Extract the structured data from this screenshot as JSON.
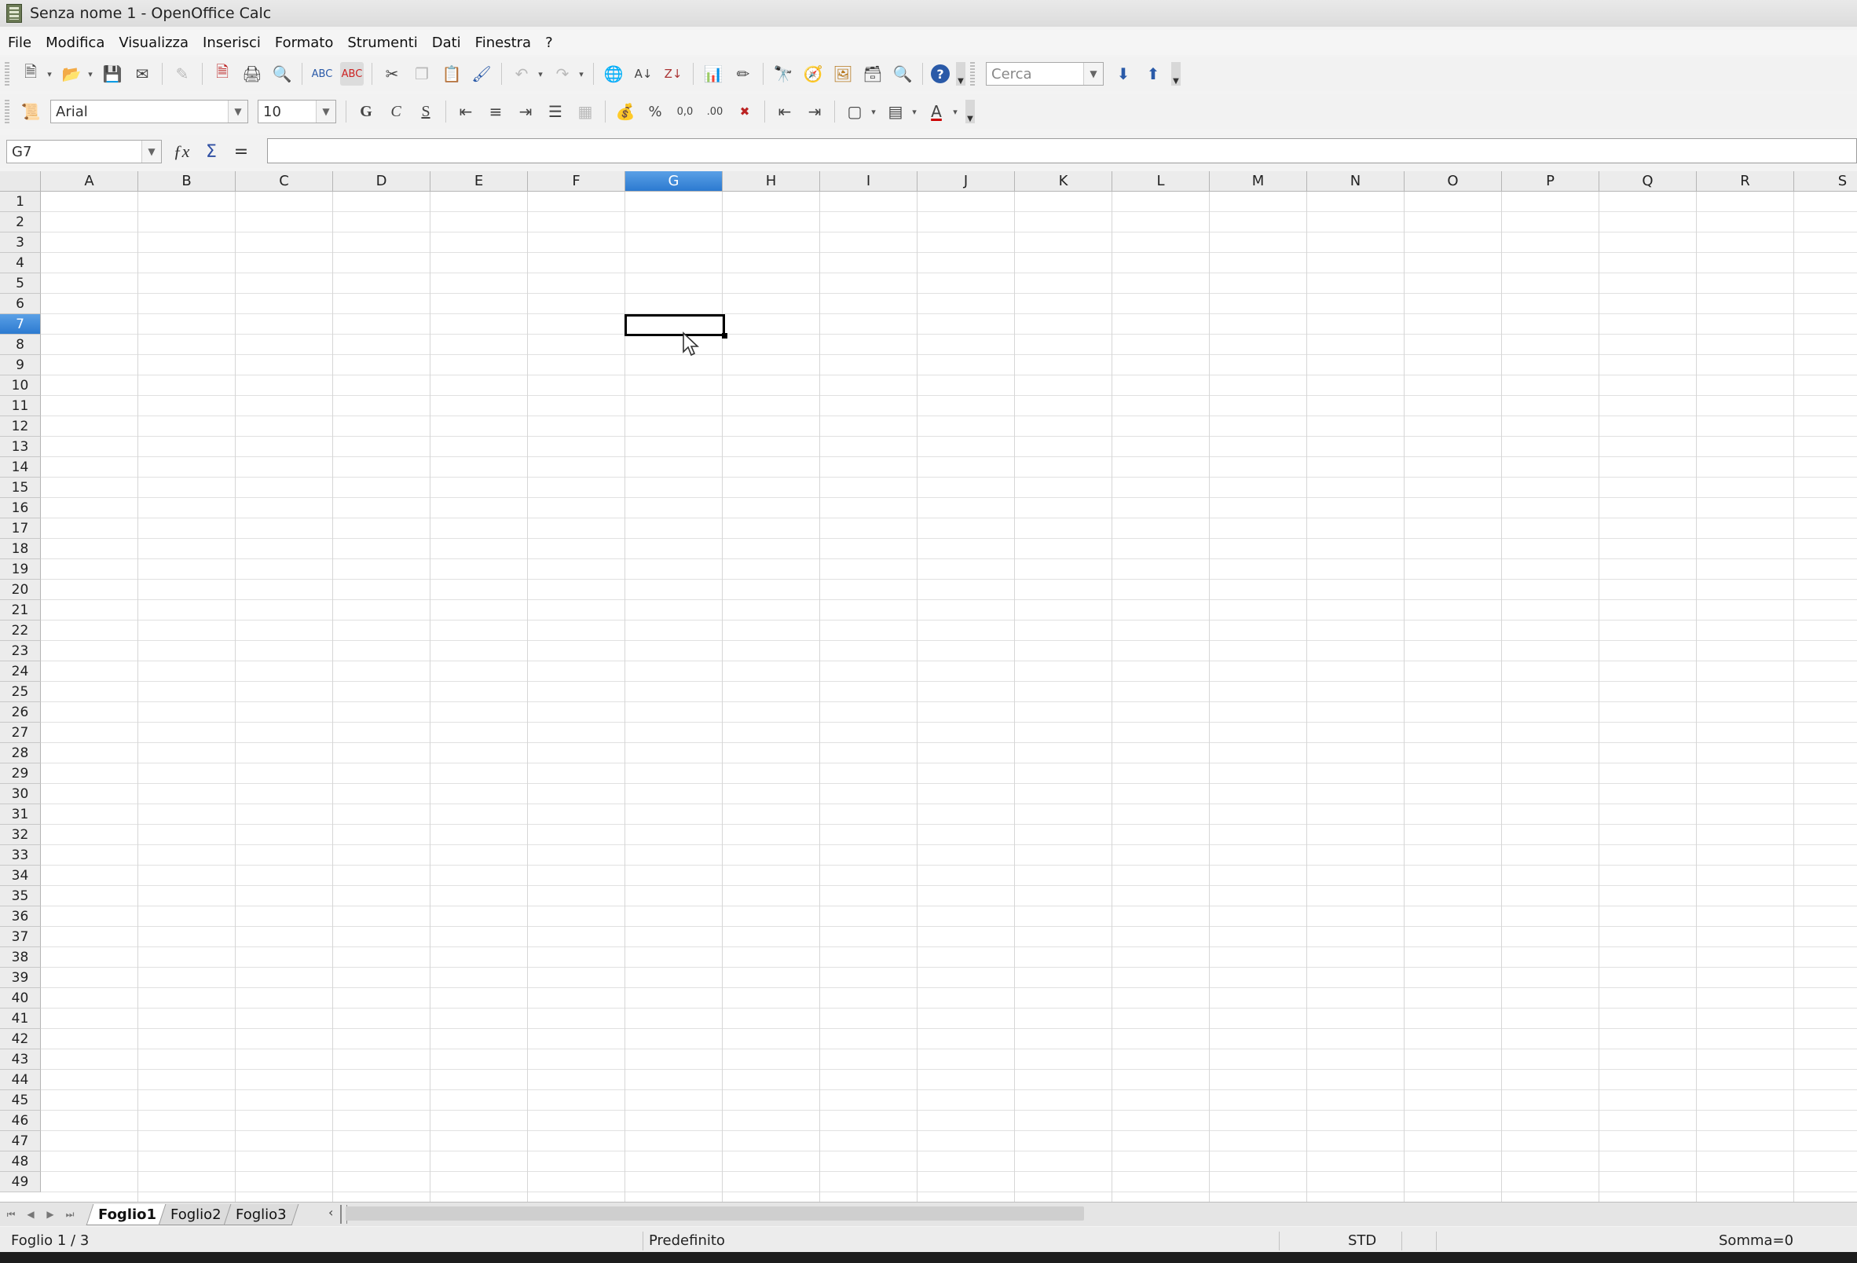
{
  "window": {
    "title": "Senza nome 1 - OpenOffice Calc"
  },
  "menu": [
    "File",
    "Modifica",
    "Visualizza",
    "Inserisci",
    "Formato",
    "Strumenti",
    "Dati",
    "Finestra",
    "?"
  ],
  "toolbar_standard": {
    "icons": [
      "new-document-icon",
      "open-icon",
      "save-icon",
      "email-icon",
      "edit-file-icon",
      "export-pdf-icon",
      "print-icon",
      "print-preview-icon",
      "spellcheck-icon",
      "autospellcheck-icon",
      "cut-icon",
      "copy-icon",
      "paste-icon",
      "format-paintbrush-icon",
      "undo-icon",
      "redo-icon",
      "hyperlink-icon",
      "sort-ascending-icon",
      "sort-descending-icon",
      "insert-chart-icon",
      "draw-functions-icon",
      "find-replace-icon",
      "navigator-icon",
      "gallery-icon",
      "data-sources-icon",
      "zoom-icon",
      "help-icon"
    ],
    "search_placeholder": "Cerca"
  },
  "toolbar_formatting": {
    "font_name": "Arial",
    "font_size": "10",
    "bold_label": "G",
    "italic_label": "C",
    "underline_label": "S",
    "percent_label": "%"
  },
  "formula_bar": {
    "name_box": "G7",
    "formula": "",
    "accept_label": "="
  },
  "sheet": {
    "columns": [
      "A",
      "B",
      "C",
      "D",
      "E",
      "F",
      "G",
      "H",
      "I",
      "J",
      "K",
      "L",
      "M",
      "N",
      "O",
      "P",
      "Q",
      "R",
      "S"
    ],
    "rows": [
      "1",
      "2",
      "3",
      "4",
      "5",
      "6",
      "7",
      "8",
      "9",
      "10",
      "11",
      "12",
      "13",
      "14",
      "15",
      "16",
      "17",
      "18",
      "19",
      "20",
      "21",
      "22",
      "23",
      "24",
      "25",
      "26",
      "27",
      "28",
      "29",
      "30",
      "31",
      "32",
      "33",
      "34",
      "35",
      "36",
      "37",
      "38",
      "39",
      "40",
      "41",
      "42",
      "43",
      "44",
      "45",
      "46",
      "47",
      "48",
      "49"
    ],
    "active_column": "G",
    "active_row": "7"
  },
  "tabs": [
    "Foglio1",
    "Foglio2",
    "Foglio3"
  ],
  "active_tab": "Foglio1",
  "status": {
    "sheet_info": "Foglio 1 / 3",
    "page_style": "Predefinito",
    "mode": "STD",
    "sum": "Somma=0"
  },
  "colors": {
    "accent": "#3a86d8",
    "selection_border": "#000000"
  }
}
